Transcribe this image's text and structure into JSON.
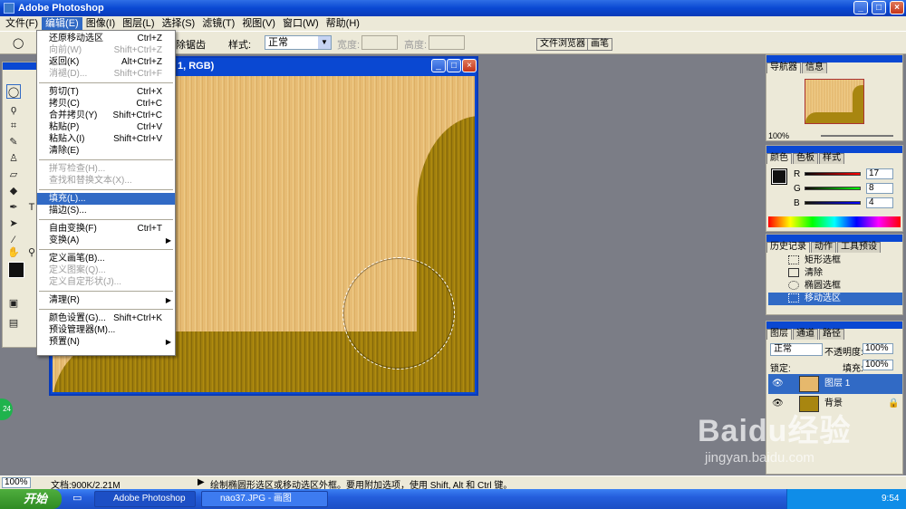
{
  "app": {
    "title": "Adobe Photoshop"
  },
  "menubar": [
    "文件(F)",
    "编辑(E)",
    "图像(I)",
    "图层(L)",
    "选择(S)",
    "滤镜(T)",
    "视图(V)",
    "窗口(W)",
    "帮助(H)"
  ],
  "options": {
    "feather_suffix": "除锯齿",
    "style_label": "样式:",
    "style_value": "正常",
    "width_label": "宽度:",
    "height_label": "高度:",
    "tab1": "文件浏览器",
    "tab2": "画笔"
  },
  "document": {
    "title": "1, RGB)"
  },
  "edit_menu": [
    {
      "label": "还原移动选区",
      "shortcut": "Ctrl+Z",
      "state": "normal"
    },
    {
      "label": "向前(W)",
      "shortcut": "Shift+Ctrl+Z",
      "state": "disabled"
    },
    {
      "label": "返回(K)",
      "shortcut": "Alt+Ctrl+Z",
      "state": "normal"
    },
    {
      "label": "消褪(D)...",
      "shortcut": "Shift+Ctrl+F",
      "state": "disabled"
    },
    {
      "label": "剪切(T)",
      "shortcut": "Ctrl+X",
      "state": "normal"
    },
    {
      "label": "拷贝(C)",
      "shortcut": "Ctrl+C",
      "state": "normal"
    },
    {
      "label": "合并拷贝(Y)",
      "shortcut": "Shift+Ctrl+C",
      "state": "normal"
    },
    {
      "label": "粘贴(P)",
      "shortcut": "Ctrl+V",
      "state": "normal"
    },
    {
      "label": "粘贴入(I)",
      "shortcut": "Shift+Ctrl+V",
      "state": "normal"
    },
    {
      "label": "清除(E)",
      "shortcut": "",
      "state": "normal"
    },
    {
      "label": "拼写检查(H)...",
      "shortcut": "",
      "state": "disabled"
    },
    {
      "label": "查找和替换文本(X)...",
      "shortcut": "",
      "state": "disabled"
    },
    {
      "label": "填充(L)...",
      "shortcut": "",
      "state": "highlight"
    },
    {
      "label": "描边(S)...",
      "shortcut": "",
      "state": "normal"
    },
    {
      "label": "自由变换(F)",
      "shortcut": "Ctrl+T",
      "state": "normal"
    },
    {
      "label": "变换(A)",
      "shortcut": "",
      "state": "submenu"
    },
    {
      "label": "定义画笔(B)...",
      "shortcut": "",
      "state": "normal"
    },
    {
      "label": "定义图案(Q)...",
      "shortcut": "",
      "state": "disabled"
    },
    {
      "label": "定义自定形状(J)...",
      "shortcut": "",
      "state": "disabled"
    },
    {
      "label": "清理(R)",
      "shortcut": "",
      "state": "submenu"
    },
    {
      "label": "颜色设置(G)...",
      "shortcut": "Shift+Ctrl+K",
      "state": "normal"
    },
    {
      "label": "预设管理器(M)...",
      "shortcut": "",
      "state": "normal"
    },
    {
      "label": "预置(N)",
      "shortcut": "",
      "state": "submenu"
    }
  ],
  "navigator": {
    "tabs": [
      "导航器",
      "信息"
    ],
    "zoom": "100%"
  },
  "color": {
    "tabs": [
      "颜色",
      "色板",
      "样式"
    ],
    "r_label": "R",
    "g_label": "G",
    "b_label": "B",
    "r": "17",
    "g": "8",
    "b": "4"
  },
  "history": {
    "tabs": [
      "历史记录",
      "动作",
      "工具预设"
    ],
    "items": [
      "矩形选框",
      "清除",
      "椭圆选框",
      "移动选区"
    ]
  },
  "layers": {
    "tabs": [
      "图层",
      "通道",
      "路径"
    ],
    "blend": "正常",
    "opacity_label": "不透明度:",
    "opacity": "100%",
    "lock_label": "锁定:",
    "fill_label": "填充:",
    "fill": "100%",
    "items": [
      "图层 1",
      "背景"
    ]
  },
  "status": {
    "zoom": "100%",
    "doc": "文档:900K/2.21M",
    "hint": "绘制椭圆形选区或移动选区外框。要用附加选项，使用 Shift, Alt 和 Ctrl 键。"
  },
  "taskbar": {
    "start": "开始",
    "tasks": [
      "Adobe Photoshop",
      "nao37.JPG - 画图"
    ],
    "time": "9:54"
  },
  "watermark": {
    "brand": "Baidu经验",
    "url": "jingyan.baidu.com"
  },
  "badge": "24",
  "colors": {
    "highlight": "#316ac5",
    "titlebar": "#0a48d2",
    "chrome": "#ece9d8"
  }
}
